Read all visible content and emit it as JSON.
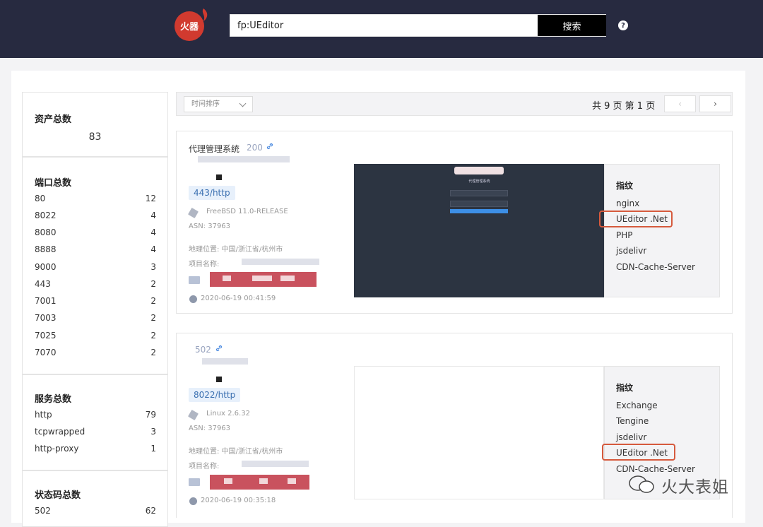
{
  "header": {
    "logo_text": "火器",
    "search": {
      "value": "fp:UEditor",
      "button_label": "搜索"
    },
    "help_label": "?"
  },
  "sidebar": {
    "assets": {
      "title": "资产总数",
      "count": "83"
    },
    "ports": {
      "title": "端口总数",
      "items": [
        {
          "label": "80",
          "count": "12"
        },
        {
          "label": "8022",
          "count": "4"
        },
        {
          "label": "8080",
          "count": "4"
        },
        {
          "label": "8888",
          "count": "4"
        },
        {
          "label": "9000",
          "count": "3"
        },
        {
          "label": "443",
          "count": "2"
        },
        {
          "label": "7001",
          "count": "2"
        },
        {
          "label": "7003",
          "count": "2"
        },
        {
          "label": "7025",
          "count": "2"
        },
        {
          "label": "7070",
          "count": "2"
        }
      ]
    },
    "services": {
      "title": "服务总数",
      "items": [
        {
          "label": "http",
          "count": "79"
        },
        {
          "label": "tcpwrapped",
          "count": "3"
        },
        {
          "label": "http-proxy",
          "count": "1"
        }
      ]
    },
    "status_codes": {
      "title": "状态码总数",
      "items": [
        {
          "label": "502",
          "count": "62"
        }
      ]
    }
  },
  "toolbar": {
    "sort_label": "时间排序",
    "page_info": "共 9 页  第 1 页",
    "prev_label": "‹",
    "next_label": "›"
  },
  "results": [
    {
      "title": "代理管理系统",
      "status": "200",
      "port_tag": "443/http",
      "os": "FreeBSD 11.0-RELEASE",
      "asn": "ASN: 37963",
      "location": "地理位置: 中国/浙江省/杭州市",
      "project": "项目名称:",
      "time": "2020-06-19 00:41:59",
      "preview_title": "代理管理系统",
      "fingerprint_title": "指纹",
      "fingerprints": [
        "nginx",
        "UEditor .Net",
        "PHP",
        "jsdelivr",
        "CDN-Cache-Server"
      ]
    },
    {
      "title": "",
      "status": "502",
      "port_tag": "8022/http",
      "os": "Linux 2.6.32",
      "asn": "ASN: 37963",
      "location": "地理位置: 中国/浙江省/杭州市",
      "project": "项目名称:",
      "time": "2020-06-19 00:35:18",
      "preview_title": "",
      "fingerprint_title": "指纹",
      "fingerprints": [
        "Exchange",
        "Tengine",
        "jsdelivr",
        "UEditor .Net",
        "CDN-Cache-Server"
      ]
    }
  ],
  "watermark": "火大表姐",
  "colors": {
    "header_bg": "#272a40",
    "highlight": "#d65a3d",
    "port_tag_bg": "#e7f0fb",
    "redacted": "#c9525e"
  }
}
